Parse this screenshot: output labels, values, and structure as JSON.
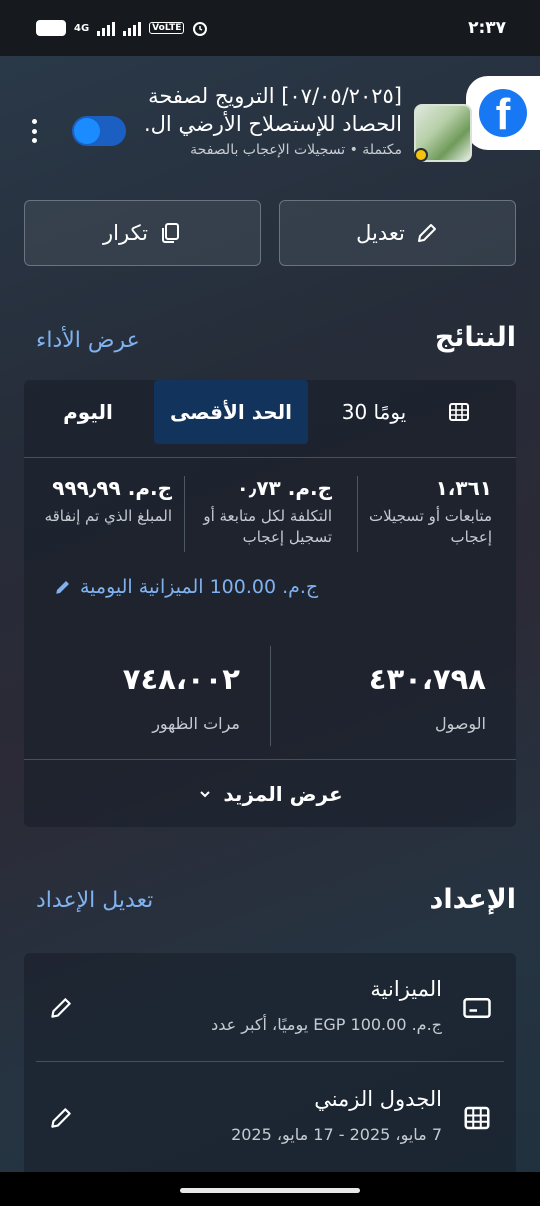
{
  "status_bar": {
    "time": "٢:٣٧",
    "battery": "٢٠",
    "network": "4G",
    "volte": "VoLTE"
  },
  "ad": {
    "title": "[٠٧/٠٥/٢٠٢٥] الترويج لصفحة الحصاد للإستصلاح الأرضي ال.",
    "status": "مكتملة • تسجيلات الإعجاب بالصفحة",
    "active": true
  },
  "actions": {
    "edit": "تعديل",
    "duplicate": "تكرار"
  },
  "results": {
    "title": "النتائج",
    "view_performance": "عرض الأداء",
    "tabs": [
      "اليوم",
      "الحد الأقصى",
      "30 يومًا"
    ],
    "selected_tab": "الحد الأقصى",
    "metrics": [
      {
        "value": "١،٣٦١",
        "label": "متابعات أو تسجيلات إعجاب"
      },
      {
        "value": "ج.م. ٠٫٧٣",
        "label": "التكلفة لكل متابعة أو تسجيل إعجاب"
      },
      {
        "value": "ج.م. ٩٩٩٫٩٩",
        "label": "المبلغ الذي تم إنفاقه"
      }
    ],
    "daily_budget": "ج.م. 100.00 الميزانية اليومية",
    "reach": {
      "value": "٤٣٠،٧٩٨",
      "label": "الوصول"
    },
    "impressions": {
      "value": "٧٤٨،٠٠٢",
      "label": "مرات الظهور"
    },
    "see_more": "عرض المزيد"
  },
  "setup": {
    "title": "الإعداد",
    "edit_setup": "تعديل الإعداد",
    "budget": {
      "title": "الميزانية",
      "value": "ج.م. EGP 100.00 يوميًا، أكبر عدد"
    },
    "schedule": {
      "title": "الجدول الزمني",
      "value": "7 مايو، 2025 - 17 مايو، 2025"
    }
  },
  "colors": {
    "accent_link": "#7fb2ee",
    "selected_tab": "#11335c",
    "facebook": "#1877f2"
  }
}
